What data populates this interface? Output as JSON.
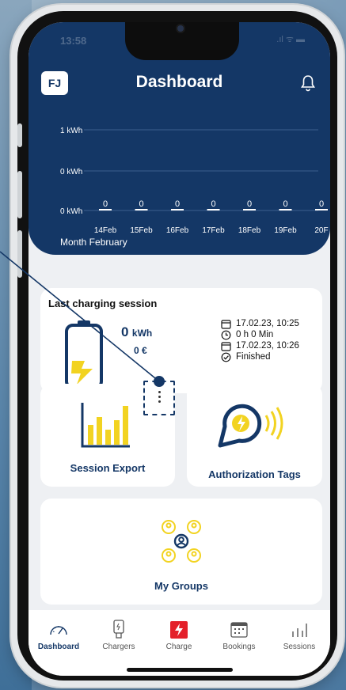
{
  "status_bar": {
    "time": "13:58",
    "icons": ".ıl ᯤ ▬"
  },
  "header": {
    "avatar_initials": "FJ",
    "title": "Dashboard",
    "bell_icon": "bell-icon"
  },
  "chart_data": {
    "type": "bar",
    "y_gridlines": [
      "1 kWh",
      "0 kWh",
      "0 kWh"
    ],
    "categories": [
      "14Feb",
      "15Feb",
      "16Feb",
      "17Feb",
      "18Feb",
      "19Feb",
      "20F"
    ],
    "value_labels": [
      "0",
      "0",
      "0",
      "0",
      "0",
      "0",
      "0"
    ],
    "values": [
      0,
      0,
      0,
      0,
      0,
      0,
      0
    ],
    "ylabel": "kWh"
  },
  "month_label": "Month February",
  "last_session": {
    "title": "Last charging session",
    "kwh_value": "0",
    "kwh_unit": "kWh",
    "euro": "0 €",
    "start": "17.02.23, 10:25",
    "duration": "0 h 0 Min",
    "end": "17.02.23, 10:26",
    "status": "Finished"
  },
  "cards": {
    "export_label": "Session Export",
    "tags_label": "Authorization Tags",
    "groups_label": "My Groups"
  },
  "tabs": [
    {
      "label": "Dashboard",
      "icon": "speedometer-icon",
      "active": true
    },
    {
      "label": "Chargers",
      "icon": "charger-icon"
    },
    {
      "label": "Charge",
      "icon": "lightning-icon"
    },
    {
      "label": "Bookings",
      "icon": "calendar-icon"
    },
    {
      "label": "Sessions",
      "icon": "bar-chart-icon"
    }
  ],
  "colors": {
    "primary": "#143766",
    "accent_yellow": "#f2d321",
    "charge_red": "#e4202a",
    "background": "#eef0f3"
  }
}
